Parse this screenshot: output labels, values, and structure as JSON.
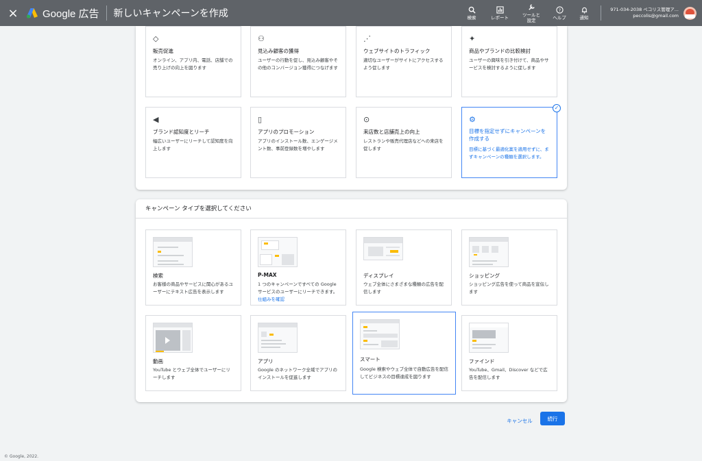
{
  "header": {
    "close_icon": "×",
    "logo_text": "Google 広告",
    "title": "新しいキャンペーンを作成",
    "actions": [
      {
        "icon": "search-icon",
        "label": "検索"
      },
      {
        "icon": "report-icon",
        "label": "レポート"
      },
      {
        "icon": "tools-icon",
        "label": "ツールと\n設定"
      },
      {
        "icon": "help-icon",
        "label": "ヘルプ"
      },
      {
        "icon": "bell-icon",
        "label": "通知"
      }
    ],
    "account": {
      "id": "971-034-2038 ペコリス管理ア...",
      "email": "peccolis@gmail.com"
    }
  },
  "goals": [
    {
      "icon": "tag-icon",
      "glyph": "◇",
      "title": "販売促進",
      "desc": "オンライン、アプリ内、電話、店舗での売り上げの向上を図ります"
    },
    {
      "icon": "people-icon",
      "glyph": "⚇",
      "title": "見込み顧客の獲得",
      "desc": "ユーザーの行動を促し、見込み顧客やその他のコンバージョン獲得につなげます"
    },
    {
      "icon": "cursor-click-icon",
      "glyph": "⋰",
      "title": "ウェブサイトのトラフィック",
      "desc": "適切なユーザーがサイトにアクセスするよう促します"
    },
    {
      "icon": "sparkle-icon",
      "glyph": "✦",
      "title": "商品やブランドの比較検討",
      "desc": "ユーザーの興味を引き付けて、商品やサービスを検討するように促します"
    },
    {
      "icon": "megaphone-icon",
      "glyph": "◀",
      "title": "ブランド認知度とリーチ",
      "desc": "幅広いユーザーにリーチして認知度を向上します"
    },
    {
      "icon": "phone-icon",
      "glyph": "▯",
      "title": "アプリのプロモーション",
      "desc": "アプリのインストール数、エンゲージメント数、事前登録数を増やします"
    },
    {
      "icon": "location-pin-icon",
      "glyph": "⊙",
      "title": "来店数と店舗売上の向上",
      "desc": "レストランや販売代理店などへの来店を促します"
    },
    {
      "icon": "gear-icon",
      "glyph": "⚙",
      "title": "目標を指定せずにキャンペーンを作成する",
      "desc": "目標に基づく最適化案を適用せずに、まずキャンペーンの種類を選択します。"
    }
  ],
  "campaign_section_title": "キャンペーン タイプを選択してください",
  "campaign_types": [
    {
      "title": "検索",
      "desc": "お客様の商品やサービスに関心があるユーザーにテキスト広告を表示します"
    },
    {
      "title": "P-MAX",
      "desc": "1 つのキャンペーンですべての Google サービスのユーザーにリーチできます。",
      "link": "仕組みを確認"
    },
    {
      "title": "ディスプレイ",
      "desc": "ウェブ全体にさまざまな種類の広告を配信します"
    },
    {
      "title": "ショッピング",
      "desc": "ショッピング広告を使って商品を宣伝します"
    },
    {
      "title": "動画",
      "desc": "YouTube とウェブ全体でユーザーにリーチします"
    },
    {
      "title": "アプリ",
      "desc": "Google のネットワーク全域でアプリのインストールを促進します"
    },
    {
      "title": "スマート",
      "desc": "Google 検索やウェブ全体で自動広告を配信してビジネスの目標達成を図ります"
    },
    {
      "title": "ファインド",
      "desc": "YouTube、Gmail、Discover などで広告を配信します"
    }
  ],
  "buttons": {
    "cancel": "キャンセル",
    "continue": "続行"
  },
  "footer": "© Google, 2022.",
  "colors": {
    "accent": "#1a73e8",
    "header_bg": "#5f6368",
    "thumb_yellow": "#fbbc04"
  }
}
